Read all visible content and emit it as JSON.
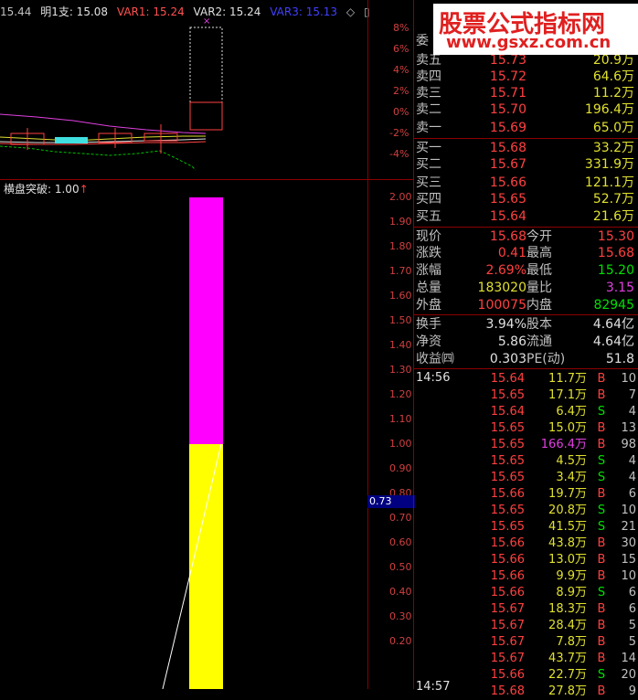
{
  "top_legend": {
    "items": [
      {
        "text": "15.44",
        "color": "#c0c0c0"
      },
      {
        "text": "明1支: 15.08",
        "color": "#e0e0e0"
      },
      {
        "text": "VAR1: 15.24",
        "color": "#ff5050"
      },
      {
        "text": "VAR2: 15.24",
        "color": "#e0e0e0"
      },
      {
        "text": "VAR3: 15.13",
        "color": "#4040ff"
      },
      {
        "text": "◇",
        "color": "#c0c0c0"
      },
      {
        "text": "▯",
        "color": "#c0c0c0"
      }
    ]
  },
  "upper_axis": [
    "8%",
    "6%",
    "4%",
    "2%",
    "0%",
    "-2%",
    "-4%"
  ],
  "lower_legend": "横盘突破: 1.00",
  "lower_axis": [
    "2.00",
    "1.90",
    "1.80",
    "1.70",
    "1.60",
    "1.50",
    "1.40",
    "1.30",
    "1.20",
    "1.10",
    "1.00",
    "0.90",
    "0.80",
    "0.70",
    "0.60",
    "0.50",
    "0.40",
    "0.30",
    "0.20"
  ],
  "cursor_value": "0.73",
  "logo": {
    "title": "股票公式指标网",
    "url": "www.gsxz.com.cn"
  },
  "quote": {
    "wei_label": "委",
    "sell": [
      {
        "label": "卖五",
        "price": "15.73",
        "vol": "20.9万"
      },
      {
        "label": "卖四",
        "price": "15.72",
        "vol": "64.6万"
      },
      {
        "label": "卖三",
        "price": "15.71",
        "vol": "11.2万"
      },
      {
        "label": "卖二",
        "price": "15.70",
        "vol": "196.4万"
      },
      {
        "label": "卖一",
        "price": "15.69",
        "vol": "65.0万"
      }
    ],
    "buy": [
      {
        "label": "买一",
        "price": "15.68",
        "vol": "33.2万"
      },
      {
        "label": "买二",
        "price": "15.67",
        "vol": "331.9万"
      },
      {
        "label": "买三",
        "price": "15.66",
        "vol": "121.1万"
      },
      {
        "label": "买四",
        "price": "15.65",
        "vol": "52.7万"
      },
      {
        "label": "买五",
        "price": "15.64",
        "vol": "21.6万"
      }
    ],
    "stats1": [
      {
        "l1": "现价",
        "v1": "15.68",
        "c1": "red",
        "l2": "今开",
        "v2": "15.30",
        "c2": "red"
      },
      {
        "l1": "涨跌",
        "v1": "0.41",
        "c1": "red",
        "l2": "最高",
        "v2": "15.68",
        "c2": "red"
      },
      {
        "l1": "涨幅",
        "v1": "2.69%",
        "c1": "red",
        "l2": "最低",
        "v2": "15.20",
        "c2": "green"
      },
      {
        "l1": "总量",
        "v1": "183020",
        "c1": "yellow",
        "l2": "量比",
        "v2": "3.15",
        "c2": "magenta"
      },
      {
        "l1": "外盘",
        "v1": "100075",
        "c1": "red",
        "l2": "内盘",
        "v2": "82945",
        "c2": "green"
      }
    ],
    "stats2": [
      {
        "l1": "换手",
        "v1": "3.94%",
        "l2": "股本",
        "v2": "4.64亿"
      },
      {
        "l1": "净资",
        "v1": "5.86",
        "l2": "流通",
        "v2": "4.64亿"
      },
      {
        "l1": "收益㈣",
        "v1": "0.303",
        "l2": "PE(动)",
        "v2": "51.8"
      }
    ]
  },
  "ticks": {
    "time": "14:56",
    "time_bottom": "14:57",
    "rows": [
      {
        "price": "15.64",
        "vol": "11.7万",
        "bs": "B",
        "n": "10"
      },
      {
        "price": "15.65",
        "vol": "17.1万",
        "bs": "B",
        "n": "7"
      },
      {
        "price": "15.64",
        "vol": "6.4万",
        "bs": "S",
        "n": "4"
      },
      {
        "price": "15.65",
        "vol": "15.0万",
        "bs": "B",
        "n": "13"
      },
      {
        "price": "15.65",
        "vol": "166.4万",
        "bs": "B",
        "n": "98"
      },
      {
        "price": "15.65",
        "vol": "4.5万",
        "bs": "S",
        "n": "4"
      },
      {
        "price": "15.65",
        "vol": "3.4万",
        "bs": "S",
        "n": "4"
      },
      {
        "price": "15.66",
        "vol": "19.7万",
        "bs": "B",
        "n": "6"
      },
      {
        "price": "15.65",
        "vol": "20.8万",
        "bs": "S",
        "n": "10"
      },
      {
        "price": "15.65",
        "vol": "41.5万",
        "bs": "S",
        "n": "21"
      },
      {
        "price": "15.66",
        "vol": "43.8万",
        "bs": "B",
        "n": "30"
      },
      {
        "price": "15.66",
        "vol": "13.0万",
        "bs": "B",
        "n": "15"
      },
      {
        "price": "15.66",
        "vol": "9.9万",
        "bs": "B",
        "n": "10"
      },
      {
        "price": "15.66",
        "vol": "8.9万",
        "bs": "S",
        "n": "6"
      },
      {
        "price": "15.67",
        "vol": "18.3万",
        "bs": "B",
        "n": "6"
      },
      {
        "price": "15.67",
        "vol": "28.4万",
        "bs": "B",
        "n": "5"
      },
      {
        "price": "15.67",
        "vol": "7.8万",
        "bs": "B",
        "n": "5"
      },
      {
        "price": "15.67",
        "vol": "43.7万",
        "bs": "B",
        "n": "14"
      },
      {
        "price": "15.66",
        "vol": "22.7万",
        "bs": "S",
        "n": "20"
      },
      {
        "price": "15.68",
        "vol": "27.8万",
        "bs": "B",
        "n": "9"
      }
    ]
  },
  "colors": {
    "buy": "#ff4040",
    "sell": "#00e000",
    "magenta_bar": "#ff00ff",
    "yellow_bar": "#ffff00"
  }
}
